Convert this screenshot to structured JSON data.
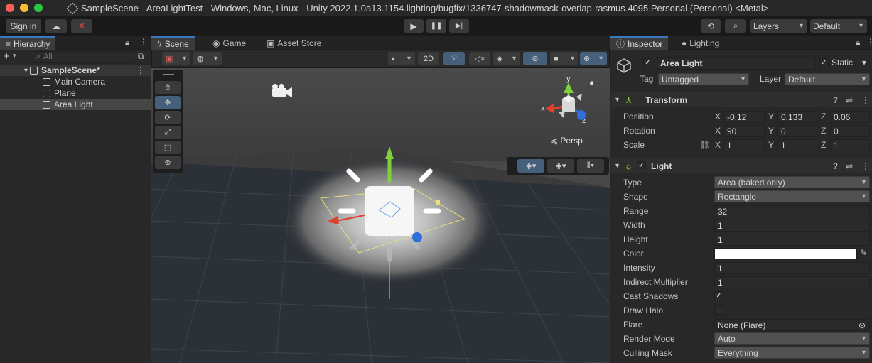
{
  "window": {
    "title": "SampleScene - AreaLightTest - Windows, Mac, Linux - Unity 2022.1.0a13.1154.lighting/bugfix/1336747-shadowmask-overlap-rasmus.4095 Personal (Personal) <Metal>"
  },
  "toolbar": {
    "sign_in": "Sign in",
    "layers": "Layers",
    "layout": "Default"
  },
  "hierarchy": {
    "tab": "Hierarchy",
    "search_placeholder": "All",
    "scene": "SampleScene*",
    "items": [
      "Main Camera",
      "Plane",
      "Area Light"
    ]
  },
  "scene_tabs": {
    "scene": "Scene",
    "game": "Game",
    "store": "Asset Store"
  },
  "scene_view": {
    "mode_2d": "2D",
    "persp": "Persp",
    "gizmo_x": "x",
    "gizmo_y": "y",
    "gizmo_z": "z"
  },
  "inspector": {
    "tab": "Inspector",
    "tab2": "Lighting",
    "object_name": "Area Light",
    "static_label": "Static",
    "tag_label": "Tag",
    "tag_value": "Untagged",
    "layer_label": "Layer",
    "layer_value": "Default",
    "transform": {
      "title": "Transform",
      "position_label": "Position",
      "position": [
        "-0.12",
        "0.133",
        "0.06"
      ],
      "rotation_label": "Rotation",
      "rotation": [
        "90",
        "0",
        "0"
      ],
      "scale_label": "Scale",
      "scale": [
        "1",
        "1",
        "1"
      ],
      "axes": [
        "X",
        "Y",
        "Z"
      ]
    },
    "light": {
      "title": "Light",
      "type_label": "Type",
      "type": "Area (baked only)",
      "shape_label": "Shape",
      "shape": "Rectangle",
      "range_label": "Range",
      "range": "32",
      "width_label": "Width",
      "width": "1",
      "height_label": "Height",
      "height": "1",
      "color_label": "Color",
      "color": "#ffffff",
      "intensity_label": "Intensity",
      "intensity": "1",
      "indirect_label": "Indirect Multiplier",
      "indirect": "1",
      "shadows_label": "Cast Shadows",
      "halo_label": "Draw Halo",
      "flare_label": "Flare",
      "flare": "None (Flare)",
      "render_label": "Render Mode",
      "render": "Auto",
      "culling_label": "Culling Mask",
      "culling": "Everything"
    }
  }
}
